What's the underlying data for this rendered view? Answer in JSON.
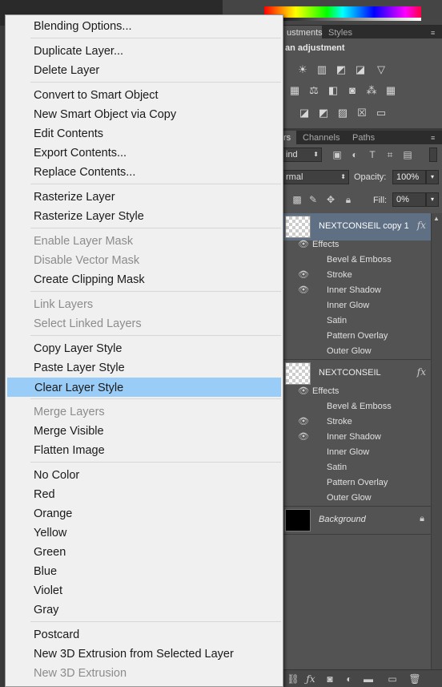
{
  "panels": {
    "adjustments_tab": "ustments",
    "styles_tab": "Styles",
    "adjust_title": "an adjustment",
    "layers_tab": "rs",
    "channels_tab": "Channels",
    "paths_tab": "Paths",
    "kind_filter": "ind",
    "blend_mode": "rmal",
    "opacity_label": "Opacity:",
    "opacity_value": "100%",
    "fill_label": "Fill:",
    "fill_value": "0%"
  },
  "layers": [
    {
      "name": "NEXTCONSEIL copy 1",
      "fx": "fx",
      "effects_label": "Effects",
      "effects": [
        "Bevel & Emboss",
        "Stroke",
        "Inner Shadow",
        "Inner Glow",
        "Satin",
        "Pattern Overlay",
        "Outer Glow"
      ]
    },
    {
      "name": "NEXTCONSEIL",
      "fx": "fx",
      "effects_label": "Effects",
      "effects": [
        "Bevel & Emboss",
        "Stroke",
        "Inner Shadow",
        "Inner Glow",
        "Satin",
        "Pattern Overlay",
        "Outer Glow"
      ]
    },
    {
      "name": "Background"
    }
  ],
  "menu": {
    "items": [
      "Blending Options...",
      "Duplicate Layer...",
      "Delete Layer",
      "Convert to Smart Object",
      "New Smart Object via Copy",
      "Edit Contents",
      "Export Contents...",
      "Replace Contents...",
      "Rasterize Layer",
      "Rasterize Layer Style",
      "Enable Layer Mask",
      "Disable Vector Mask",
      "Create Clipping Mask",
      "Link Layers",
      "Select Linked Layers",
      "Copy Layer Style",
      "Paste Layer Style",
      "Clear Layer Style",
      "Merge Layers",
      "Merge Visible",
      "Flatten Image",
      "No Color",
      "Red",
      "Orange",
      "Yellow",
      "Green",
      "Blue",
      "Violet",
      "Gray",
      "Postcard",
      "New 3D Extrusion from Selected Layer",
      "New 3D Extrusion"
    ],
    "disabled": [
      10,
      11,
      13,
      14,
      18,
      31
    ],
    "highlighted": 17
  }
}
